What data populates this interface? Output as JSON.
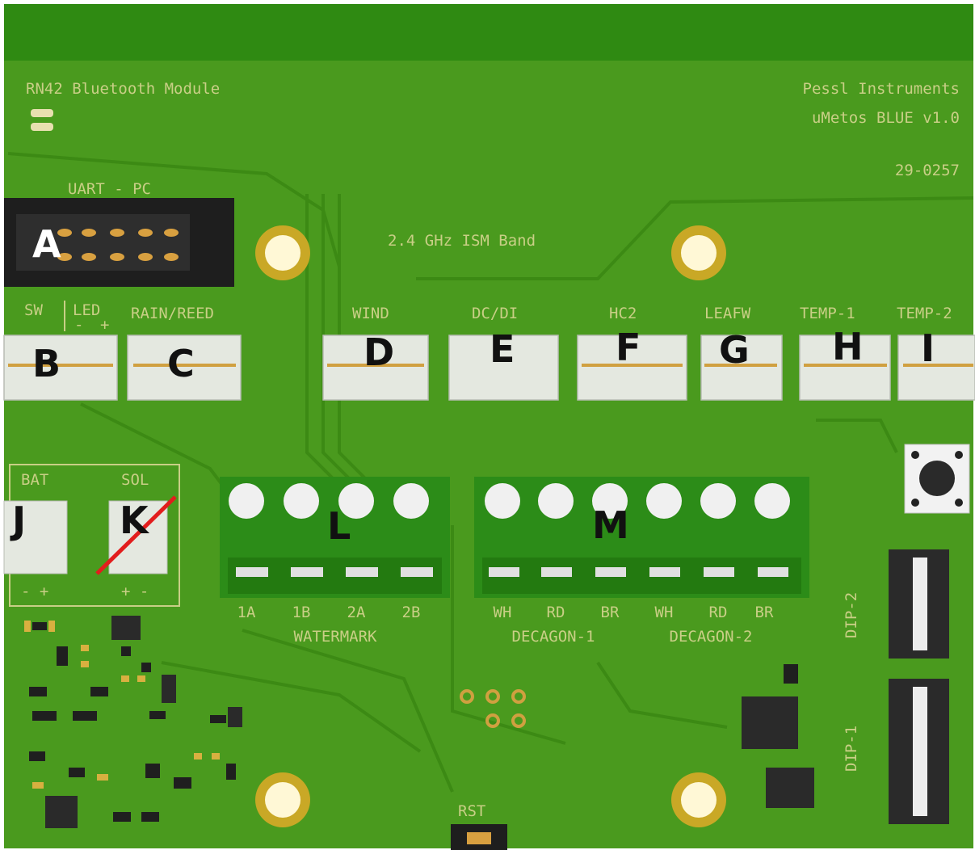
{
  "board": {
    "module_label": "RN42 Bluetooth Module",
    "maker": "Pessl Instruments",
    "model": "uMetos BLUE v1.0",
    "serial": "29-0257",
    "band_label": "2.4 GHz ISM Band",
    "uart_label": "UART - PC",
    "rst_label": "RST",
    "dip1_label": "DIP-1",
    "dip2_label": "DIP-2",
    "colors": {
      "pcb": "#4a9a1e",
      "header": "#2f8a12",
      "silk": "#c9cf86",
      "terminal": "#2c8c18",
      "pad": "#e0b04a"
    }
  },
  "connectors": {
    "sw_label": "SW",
    "led_label": "LED",
    "led_minus": "-",
    "led_plus": "+",
    "rain_label": "RAIN/REED",
    "wind_label": "WIND",
    "dc_label": "DC/DI",
    "hc2_label": "HC2",
    "leafw_label": "LEAFW",
    "temp1_label": "TEMP-1",
    "temp2_label": "TEMP-2",
    "bat_label": "BAT",
    "sol_label": "SOL",
    "bat_polarity": "- +",
    "sol_polarity": "+ -"
  },
  "terminals": {
    "watermark_pins": [
      "1A",
      "1B",
      "2A",
      "2B"
    ],
    "watermark_label": "WATERMARK",
    "decagon_pins": [
      "WH",
      "RD",
      "BR",
      "WH",
      "RD",
      "BR"
    ],
    "decagon1_label": "DECAGON-1",
    "decagon2_label": "DECAGON-2"
  },
  "annotations": {
    "A": "A",
    "B": "B",
    "C": "C",
    "D": "D",
    "E": "E",
    "F": "F",
    "G": "G",
    "H": "H",
    "I": "I",
    "J": "J",
    "K": "K",
    "L": "L",
    "M": "M"
  }
}
